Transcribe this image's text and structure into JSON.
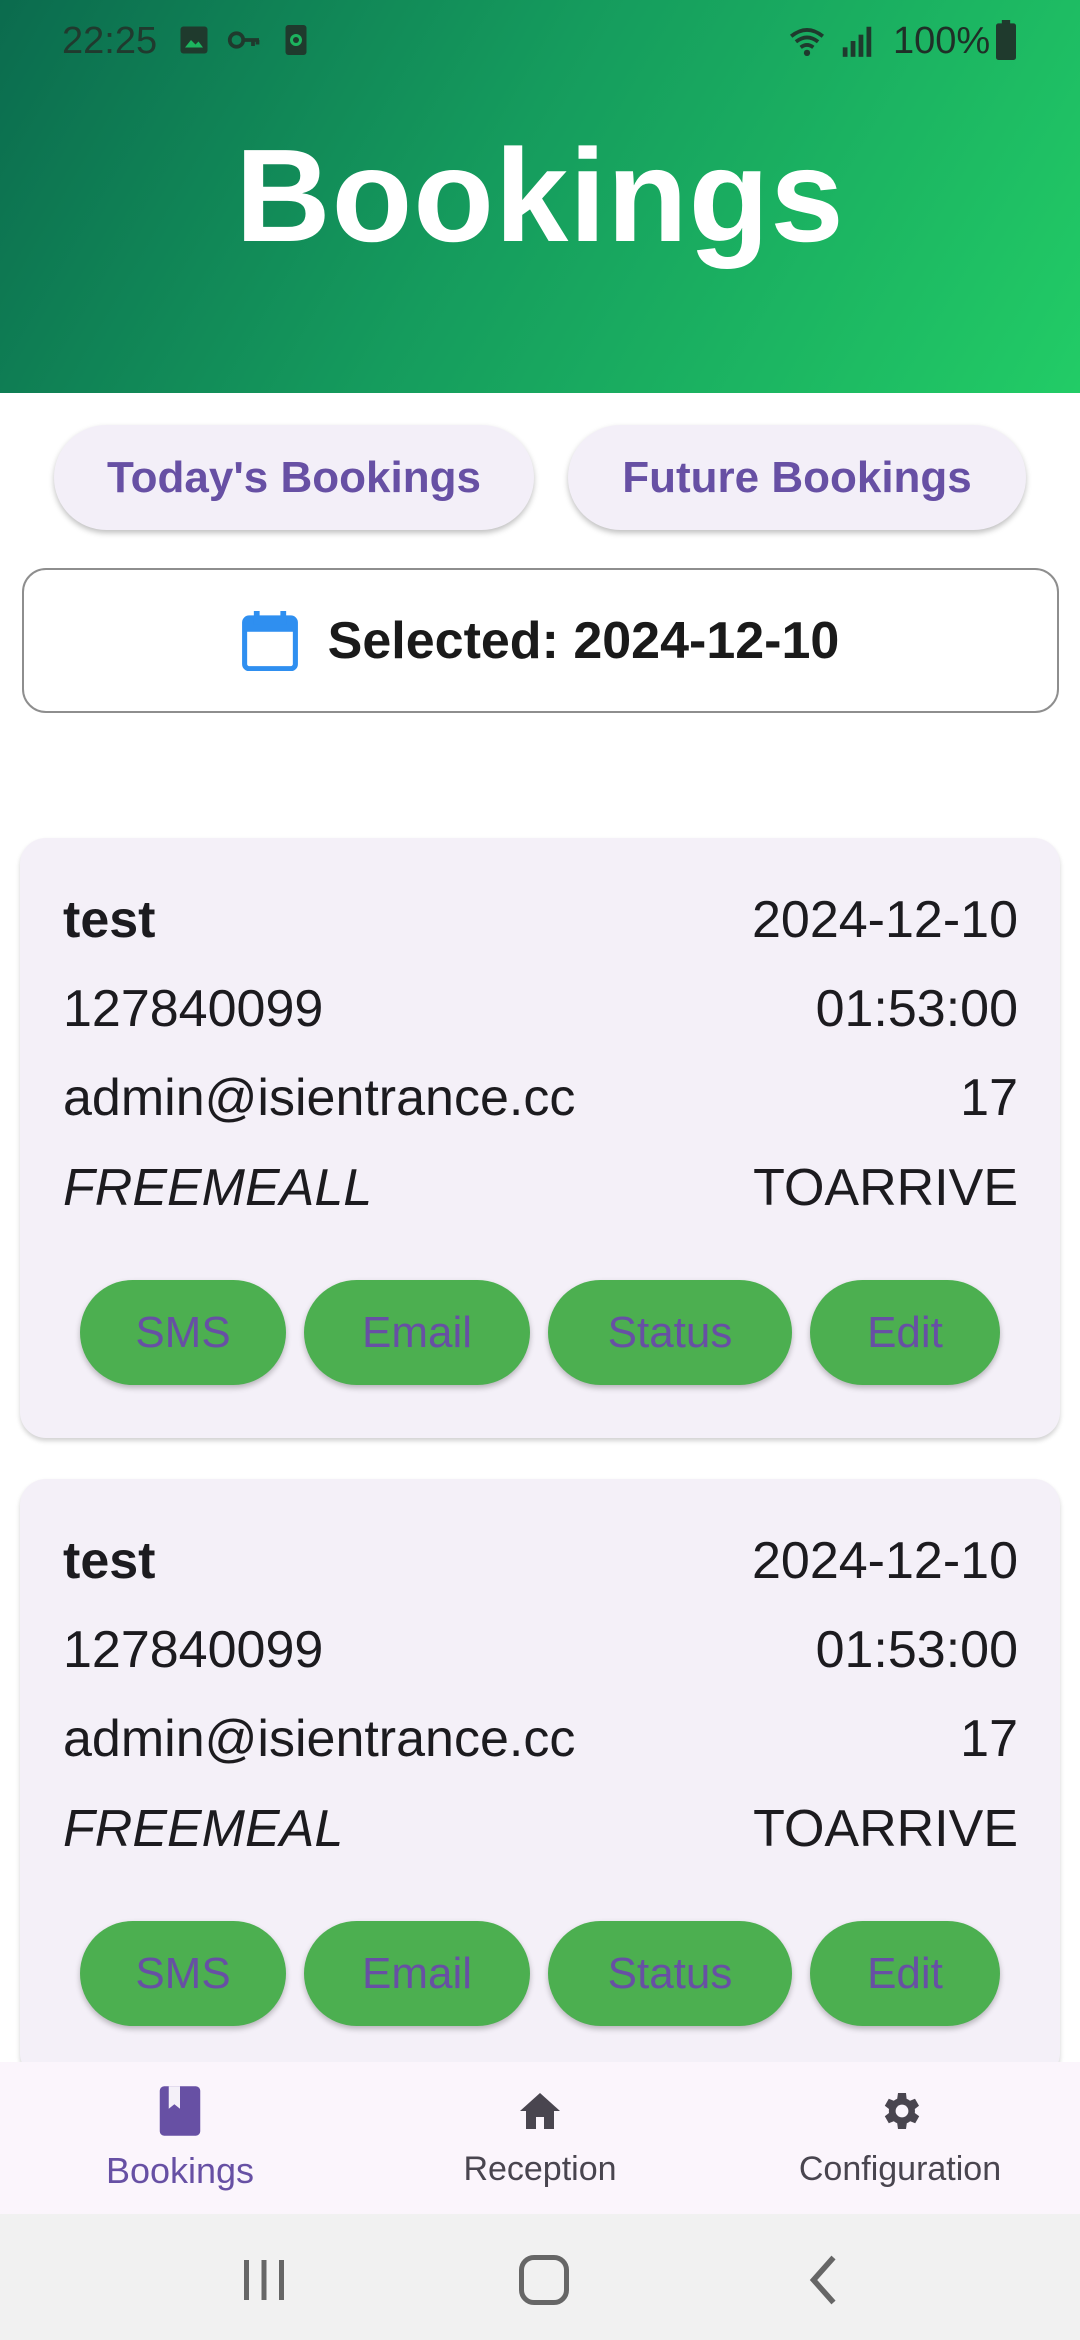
{
  "status_bar": {
    "time": "22:25",
    "battery_text": "100%",
    "icons": [
      "image-icon",
      "key-icon",
      "screen-record-icon",
      "wifi-icon",
      "signal-icon",
      "battery-icon"
    ]
  },
  "header": {
    "title": "Bookings",
    "gradient": [
      "#0b6b4e",
      "#22cc66"
    ]
  },
  "tabs": {
    "today": "Today's Bookings",
    "future": "Future Bookings"
  },
  "date_selector": {
    "icon": "calendar-icon",
    "label": "Selected: 2024-12-10"
  },
  "bookings": [
    {
      "name": "test",
      "date": "2024-12-10",
      "phone": "127840099",
      "time": "01:53:00",
      "email": "admin@isientrance.cc",
      "count": "17",
      "code": "FREEMEALL",
      "status": "TOARRIVE",
      "actions": {
        "sms": "SMS",
        "email": "Email",
        "status": "Status",
        "edit": "Edit"
      }
    },
    {
      "name": "test",
      "date": "2024-12-10",
      "phone": "127840099",
      "time": "01:53:00",
      "email": "admin@isientrance.cc",
      "count": "17",
      "code": "FREEMEAL",
      "status": "TOARRIVE",
      "actions": {
        "sms": "SMS",
        "email": "Email",
        "status": "Status",
        "edit": "Edit"
      }
    }
  ],
  "bottom_nav": {
    "items": [
      {
        "label": "Bookings",
        "icon": "book-icon",
        "active": true
      },
      {
        "label": "Reception",
        "icon": "home-icon",
        "active": false
      },
      {
        "label": "Configuration",
        "icon": "gear-icon",
        "active": false
      }
    ]
  },
  "colors": {
    "accent": "#6750a4",
    "action_green": "#4caf50",
    "card_bg": "#f4f0f8"
  }
}
